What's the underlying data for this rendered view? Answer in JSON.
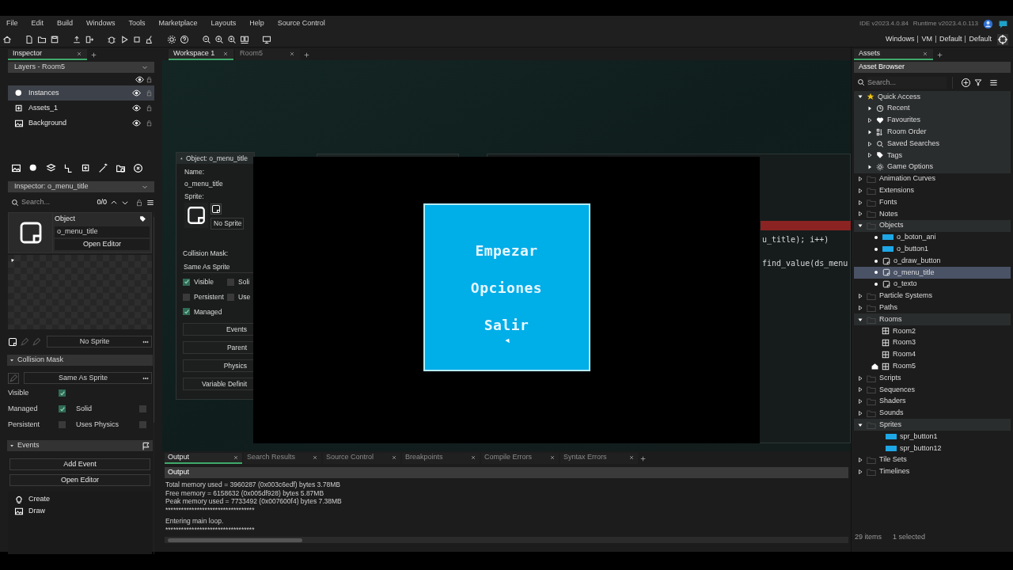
{
  "menu": [
    "File",
    "Edit",
    "Build",
    "Windows",
    "Tools",
    "Marketplace",
    "Layouts",
    "Help",
    "Source Control"
  ],
  "version": {
    "ide": "IDE v2023.4.0.84",
    "runtime": "Runtime v2023.4.0.113"
  },
  "target_bar": [
    "Windows",
    "VM",
    "Default",
    "Default"
  ],
  "inspector_tab": {
    "label": "Inspector"
  },
  "layers": {
    "title": "Layers - Room5",
    "items": [
      {
        "name": "Instances",
        "kind": "instances",
        "selected": true
      },
      {
        "name": "Assets_1",
        "kind": "assets",
        "selected": false
      },
      {
        "name": "Background",
        "kind": "background",
        "selected": false
      }
    ]
  },
  "inspector": {
    "title": "Inspector: o_menu_title",
    "search_placeholder": "Search...",
    "count": "0/0",
    "object_label": "Object",
    "object_name": "o_menu_title",
    "open_editor": "Open Editor",
    "sprite": "No Sprite",
    "collision_section": "Collision Mask",
    "mask": "Same As Sprite",
    "flag_rows": [
      [
        {
          "label": "Visible",
          "checked": true
        }
      ],
      [
        {
          "label": "Managed",
          "checked": true
        },
        {
          "label": "Solid",
          "checked": false
        }
      ],
      [
        {
          "label": "Persistent",
          "checked": false
        },
        {
          "label": "Uses Physics",
          "checked": false
        }
      ]
    ],
    "events_section": "Events",
    "buttons": [
      "Add Event",
      "Open Editor"
    ],
    "events": [
      {
        "name": "Create",
        "kind": "create"
      },
      {
        "name": "Draw",
        "kind": "draw"
      }
    ]
  },
  "workspace_tabs": [
    {
      "label": "Workspace 1",
      "selected": true
    },
    {
      "label": "Room5",
      "selected": false
    }
  ],
  "object_window": {
    "title": "Object: o_menu_title",
    "name_label": "Name:",
    "name": "o_menu_title",
    "sprite_label": "Sprite:",
    "sprite": "No Sprite",
    "mask_label": "Collision Mask:",
    "mask": "Same As Sprite",
    "flags": [
      {
        "label": "Visible",
        "checked": true
      },
      {
        "label": "Soli",
        "checked": false
      },
      {
        "label": "Persistent",
        "checked": false
      },
      {
        "label": "Use",
        "checked": false
      },
      {
        "label": "Managed",
        "checked": true
      }
    ],
    "buttons": [
      "Events",
      "Parent",
      "Physics",
      "Variable Definit"
    ]
  },
  "code_lines": [
    "u_title); i++)",
    "find_value(ds_menu"
  ],
  "game_window": {
    "menu": [
      "Empezar",
      "Opciones",
      "Salir"
    ]
  },
  "output": {
    "tabs": [
      {
        "label": "Output",
        "selected": true
      },
      {
        "label": "Search Results",
        "selected": false
      },
      {
        "label": "Source Control",
        "selected": false
      },
      {
        "label": "Breakpoints",
        "selected": false
      },
      {
        "label": "Compile Errors",
        "selected": false
      },
      {
        "label": "Syntax Errors",
        "selected": false
      }
    ],
    "header": "Output",
    "line_groups": [
      [
        "Total memory used = 3960287 (0x003c6edf) bytes 3.78MB",
        "Free memory = 6158632 (0x005df928) bytes 5.87MB",
        "Peak memory used = 7733492 (0x007600f4) bytes 7.38MB",
        "**********************************"
      ],
      [
        "Entering main loop.",
        "**********************************"
      ]
    ]
  },
  "assets": {
    "tab": "Assets",
    "header": "Asset Browser",
    "search_placeholder": "Search...",
    "tree": [
      {
        "name": "Quick Access",
        "kind": "quick",
        "expanded": true,
        "children": [
          {
            "name": "Recent",
            "kind": "recent",
            "expanded": false
          },
          {
            "name": "Favourites",
            "kind": "favourites",
            "expanded": false
          },
          {
            "name": "Room Order",
            "kind": "room_order",
            "expanded": false
          },
          {
            "name": "Saved Searches",
            "kind": "saved_searches",
            "expanded": false
          },
          {
            "name": "Tags",
            "kind": "tags",
            "expanded": false
          },
          {
            "name": "Game Options",
            "kind": "game_options",
            "expanded": false
          }
        ]
      },
      {
        "name": "Animation Curves",
        "kind": "folder",
        "expanded": false
      },
      {
        "name": "Extensions",
        "kind": "folder",
        "expanded": false
      },
      {
        "name": "Fonts",
        "kind": "folder",
        "expanded": false
      },
      {
        "name": "Notes",
        "kind": "folder",
        "expanded": false
      },
      {
        "name": "Objects",
        "kind": "folder",
        "expanded": true,
        "children": [
          {
            "name": "o_boton_ani",
            "kind": "sprite_object",
            "selected": false
          },
          {
            "name": "o_button1",
            "kind": "sprite_object",
            "selected": false
          },
          {
            "name": "o_draw_button",
            "kind": "object",
            "selected": false
          },
          {
            "name": "o_menu_title",
            "kind": "object",
            "selected": true
          },
          {
            "name": "o_texto",
            "kind": "object",
            "selected": false
          }
        ]
      },
      {
        "name": "Particle Systems",
        "kind": "folder",
        "expanded": false
      },
      {
        "name": "Paths",
        "kind": "folder",
        "expanded": false
      },
      {
        "name": "Rooms",
        "kind": "folder",
        "expanded": true,
        "children": [
          {
            "name": "Room2",
            "kind": "room",
            "home": false
          },
          {
            "name": "Room3",
            "kind": "room",
            "home": false
          },
          {
            "name": "Room4",
            "kind": "room",
            "home": false
          },
          {
            "name": "Room5",
            "kind": "room",
            "home": true
          }
        ]
      },
      {
        "name": "Scripts",
        "kind": "folder",
        "expanded": false
      },
      {
        "name": "Sequences",
        "kind": "folder",
        "expanded": false
      },
      {
        "name": "Shaders",
        "kind": "folder",
        "expanded": false
      },
      {
        "name": "Sounds",
        "kind": "folder",
        "expanded": false
      },
      {
        "name": "Sprites",
        "kind": "folder",
        "expanded": true,
        "children": [
          {
            "name": "spr_button1",
            "kind": "sprite"
          },
          {
            "name": "spr_button12",
            "kind": "sprite"
          }
        ]
      },
      {
        "name": "Tile Sets",
        "kind": "folder",
        "expanded": false
      },
      {
        "name": "Timelines",
        "kind": "folder",
        "expanded": false
      }
    ],
    "status": [
      "29 items",
      "1 selected"
    ]
  }
}
